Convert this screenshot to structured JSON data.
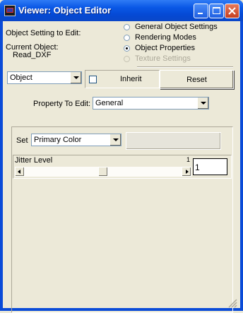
{
  "window": {
    "title": "Viewer: Object Editor"
  },
  "object_section": {
    "setting_label": "Object Setting to Edit:",
    "current_label": "Current Object:",
    "current_value": "Read_DXF"
  },
  "radios": [
    {
      "label": "General Object Settings",
      "selected": false,
      "enabled": true
    },
    {
      "label": "Rendering Modes",
      "selected": false,
      "enabled": true
    },
    {
      "label": "Object Properties",
      "selected": true,
      "enabled": true
    },
    {
      "label": "Texture Settings",
      "selected": false,
      "enabled": false
    }
  ],
  "object_combo": {
    "value": "Object"
  },
  "inherit": {
    "label": "Inherit",
    "checked": false
  },
  "reset_label": "Reset",
  "property": {
    "label": "Property To Edit:",
    "value": "General"
  },
  "set_row": {
    "label": "Set",
    "value": "Primary Color"
  },
  "jitter": {
    "label": "Jitter Level",
    "small_value": "1",
    "value": "1",
    "slider_fraction": 0.5
  }
}
